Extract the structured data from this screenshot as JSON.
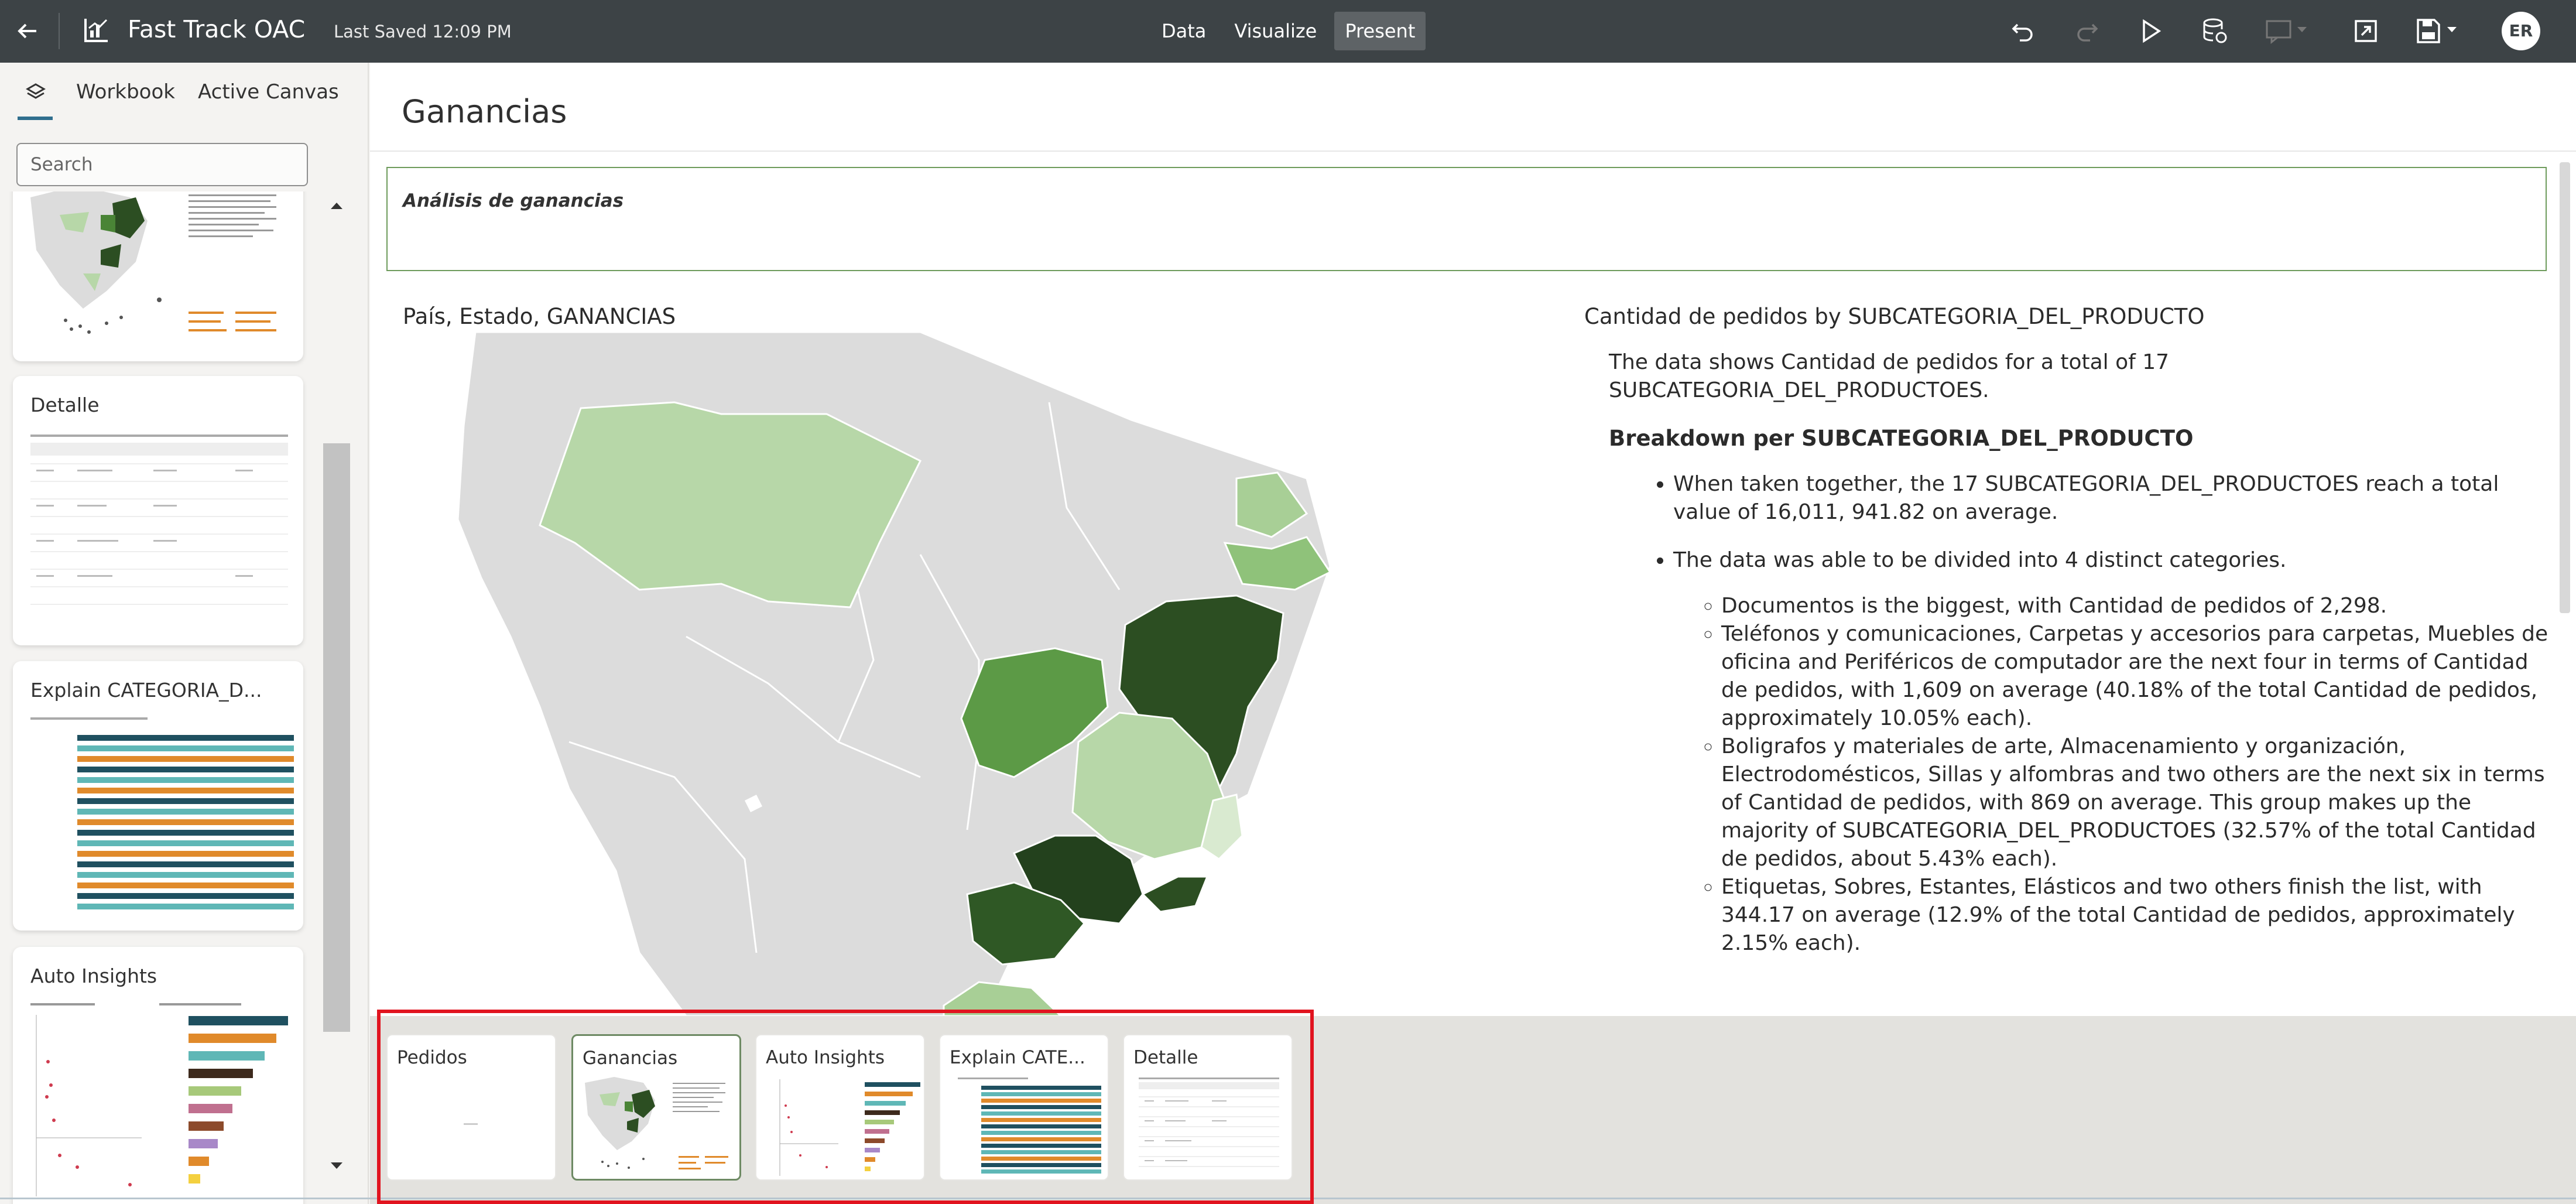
{
  "app": {
    "title": "Fast Track OAC",
    "last_saved": "Last Saved 12:09 PM",
    "modes": [
      "Data",
      "Visualize",
      "Present"
    ],
    "active_mode": "Present",
    "user_initials": "ER"
  },
  "left_panel": {
    "tabs": [
      "Workbook",
      "Active Canvas"
    ],
    "search_placeholder": "Search",
    "canvases": [
      {
        "label": ""
      },
      {
        "label": "Detalle"
      },
      {
        "label": "Explain CATEGORIA_D..."
      },
      {
        "label": "Auto Insights"
      }
    ]
  },
  "canvas": {
    "title": "Ganancias",
    "textbox": "Análisis de ganancias",
    "map_title": "País, Estado, GANANCIAS",
    "insight_title": "Cantidad de pedidos by SUBCATEGORIA_DEL_PRODUCTO",
    "insight": {
      "intro": "The data shows Cantidad de pedidos for a total of 17 SUBCATEGORIA_DEL_PRODUCTOES.",
      "breakdown_heading": "Breakdown per SUBCATEGORIA_DEL_PRODUCTO",
      "bullets": [
        "When taken together, the 17 SUBCATEGORIA_DEL_PRODUCTOES reach a total value of 16,011, 941.82 on average.",
        "The data was able to be divided into 4 distinct categories."
      ],
      "sub_bullets": [
        "Documentos is the biggest, with Cantidad de pedidos of 2,298.",
        "Teléfonos y comunicaciones, Carpetas y accesorios para carpetas, Muebles de oficina and Periféricos de computador are the next four in terms of Cantidad de pedidos, with 1,609 on average (40.18% of the total Cantidad de pedidos, approximately 10.05% each).",
        "Boligrafos y materiales de arte, Almacenamiento y organización, Electrodomésticos, Sillas y alfombras and two others are the next six in terms of Cantidad de pedidos, with 869 on average. This group makes up the majority of SUBCATEGORIA_DEL_PRODUCTOES (32.57% of the total Cantidad de pedidos, about 5.43% each).",
        "Etiquetas, Sobres, Estantes, Elásticos and two others finish the list, with 344.17 on average (12.9% of the total Cantidad de pedidos, approximately 2.15% each)."
      ]
    }
  },
  "page_strip": {
    "pages": [
      {
        "label": "Pedidos",
        "active": false
      },
      {
        "label": "Ganancias",
        "active": true
      },
      {
        "label": "Auto Insights",
        "active": false
      },
      {
        "label": "Explain CATE...",
        "active": false
      },
      {
        "label": "Detalle",
        "active": false
      }
    ]
  },
  "colors": {
    "topbar": "#3d4346",
    "map_dark": "#2c4e22",
    "map_mid": "#4a8436",
    "map_light": "#b7d7a8",
    "map_base": "#dcdcdc",
    "highlight_border": "#e1141f",
    "bar_teal_dark": "#1f5060",
    "bar_teal_light": "#5fb7b6",
    "bar_orange": "#e08a2b"
  }
}
